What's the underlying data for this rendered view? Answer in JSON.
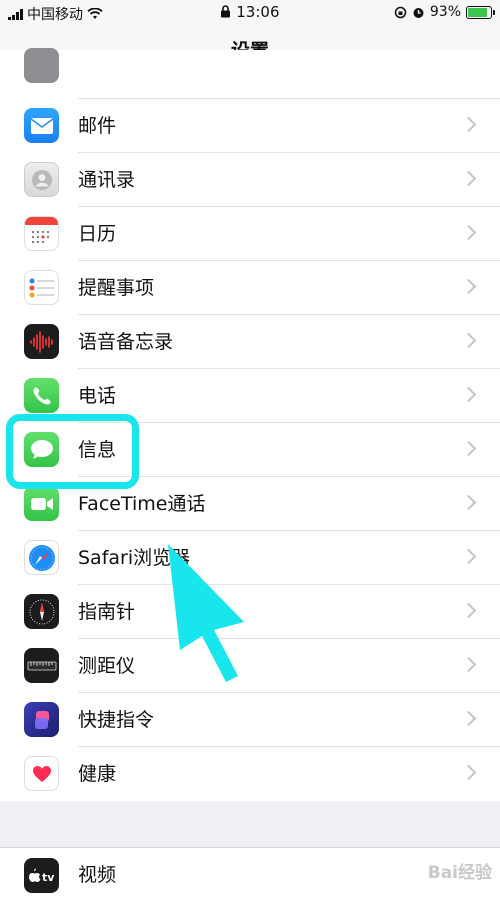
{
  "status_bar": {
    "carrier": "中国移动",
    "time": "13:06",
    "battery": "93%"
  },
  "nav": {
    "title": "设置"
  },
  "rows": [
    {
      "label": "邮件",
      "icon": "mail-icon"
    },
    {
      "label": "通讯录",
      "icon": "contacts-icon"
    },
    {
      "label": "日历",
      "icon": "calendar-icon"
    },
    {
      "label": "提醒事项",
      "icon": "reminders-icon"
    },
    {
      "label": "语音备忘录",
      "icon": "voice-memos-icon"
    },
    {
      "label": "电话",
      "icon": "phone-icon"
    },
    {
      "label": "信息",
      "icon": "messages-icon"
    },
    {
      "label": "FaceTime通话",
      "icon": "facetime-icon"
    },
    {
      "label": "Safari浏览器",
      "icon": "safari-icon"
    },
    {
      "label": "指南针",
      "icon": "compass-icon"
    },
    {
      "label": "测距仪",
      "icon": "measure-icon"
    },
    {
      "label": "快捷指令",
      "icon": "shortcuts-icon"
    },
    {
      "label": "健康",
      "icon": "health-icon"
    },
    {
      "label": "视频",
      "icon": "tv-icon"
    }
  ],
  "annotation": {
    "highlight_color": "#19e6ec",
    "target": "信息"
  },
  "watermark": "Bai经验"
}
